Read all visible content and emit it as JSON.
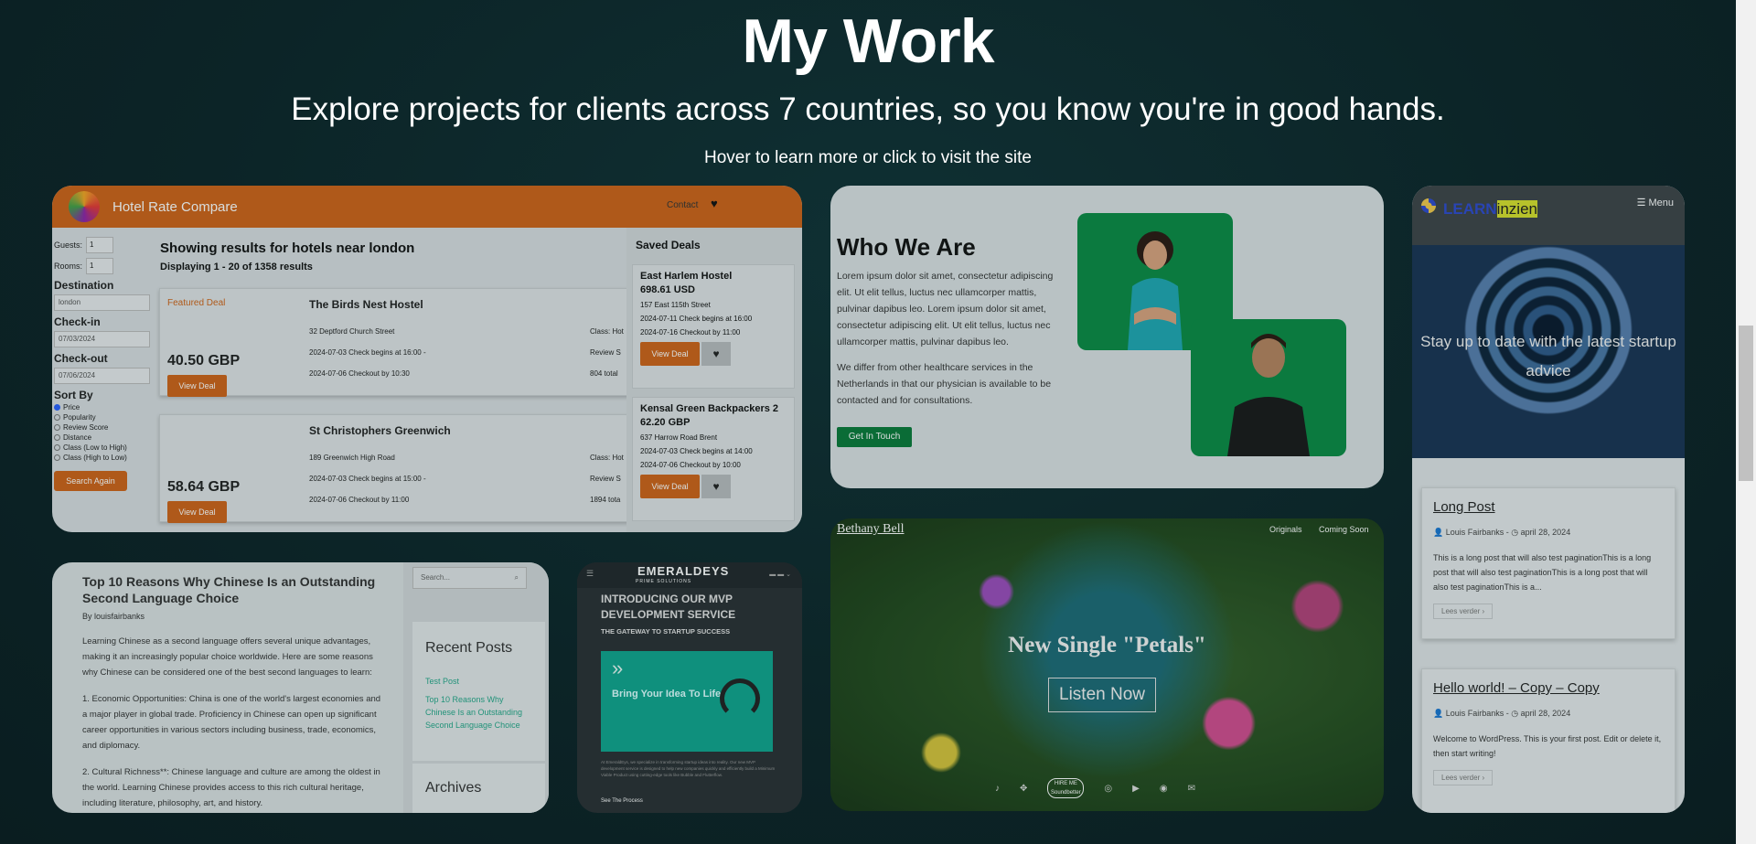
{
  "header": {
    "title": "My Work",
    "subtitle": "Explore projects for clients across 7 countries, so you know you're in good hands.",
    "hint": "Hover to learn more or click to visit the site"
  },
  "hotel": {
    "brand": "Hotel Rate Compare",
    "contact": "Contact",
    "heart_icon": "heart-icon",
    "guests_label": "Guests:",
    "guests_value": "1",
    "rooms_label": "Rooms:",
    "rooms_value": "1",
    "destination_label": "Destination",
    "destination_value": "london",
    "checkin_label": "Check-in",
    "checkin_value": "07/03/2024",
    "checkout_label": "Check-out",
    "checkout_value": "07/06/2024",
    "sortby_label": "Sort By",
    "sort_options": [
      "Price",
      "Popularity",
      "Review Score",
      "Distance",
      "Class (Low to High)",
      "Class (High to Low)"
    ],
    "search_again": "Search Again",
    "results_title": "Showing results for hotels near london",
    "results_sub": "Displaying 1 - 20 of 1358 results",
    "deals": [
      {
        "featured": "Featured Deal",
        "name": "The Birds Nest Hostel",
        "address": "32 Deptford Church Street",
        "checkin": "2024-07-03 Check begins at 16:00 -",
        "checkout": "2024-07-06 Checkout by 10:30",
        "class": "Class: Hot",
        "review": "Review S",
        "reviews": "804 total",
        "price": "40.50 GBP",
        "button": "View Deal"
      },
      {
        "featured": "",
        "name": "St Christophers Greenwich",
        "address": "189 Greenwich High Road",
        "checkin": "2024-07-03 Check begins at 15:00 -",
        "checkout": "2024-07-06 Checkout by 11:00",
        "class": "Class: Hot",
        "review": "Review S",
        "reviews": "1894 tota",
        "price": "58.64 GBP",
        "button": "View Deal"
      }
    ],
    "saved_title": "Saved Deals",
    "saved": [
      {
        "name": "East Harlem Hostel",
        "price": "698.61 USD",
        "address": "157 East 115th Street",
        "checkin": "2024-07-11 Check begins at 16:00",
        "checkout": "2024-07-16 Checkout by 11:00",
        "button": "View Deal"
      },
      {
        "name": "Kensal Green Backpackers 2",
        "price": "62.20 GBP",
        "address": "637 Harrow Road Brent",
        "checkin": "2024-07-03 Check begins at 14:00",
        "checkout": "2024-07-06 Checkout by 10:00",
        "button": "View Deal"
      }
    ]
  },
  "who": {
    "title": "Who We Are",
    "p1": "Lorem ipsum dolor sit amet, consectetur adipiscing elit. Ut elit tellus, luctus nec ullamcorper mattis, pulvinar dapibus leo. Lorem ipsum dolor sit amet, consectetur adipiscing elit. Ut elit tellus, luctus nec ullamcorper mattis, pulvinar dapibus leo.",
    "p2": "We differ from other healthcare services in the Netherlands in that our physician is available to be contacted and for consultations.",
    "button": "Get In Touch"
  },
  "learn": {
    "brand_a": "LEARN",
    "brand_b": "inzien",
    "menu": "☰  Menu",
    "hero": "Stay up to date with the latest startup advice",
    "posts": [
      {
        "title": "Long Post",
        "author": "Louis Fairbanks",
        "date": "april 28, 2024",
        "excerpt": "This is a long post that will also test paginationThis is a long post that will also test paginationThis is a long post that will also test paginationThis is a...",
        "more": "Lees verder ›"
      },
      {
        "title": "Hello world! – Copy – Copy",
        "author": "Louis Fairbanks",
        "date": "april 28, 2024",
        "excerpt": "Welcome to WordPress. This is your first post. Edit or delete it, then start writing!",
        "more": "Lees verder ›"
      }
    ]
  },
  "chinese": {
    "title": "Top 10 Reasons Why Chinese Is an Outstanding Second Language Choice",
    "byline": "By louisfairbanks",
    "p1": "Learning Chinese as a second language offers several unique advantages, making it an increasingly popular choice worldwide. Here are some reasons why Chinese can be considered one of the best second languages to learn:",
    "p2": "1. Economic Opportunities: China is one of the world's largest economies and a major player in global trade. Proficiency in Chinese can open up significant career opportunities in various sectors including business, trade, economics, and diplomacy.",
    "p3": "2. Cultural Richness**: Chinese language and culture are among the oldest in the world. Learning Chinese provides access to this rich cultural heritage, including literature, philosophy, art, and history.",
    "search_placeholder": "Search...",
    "recent_title": "Recent Posts",
    "recent": [
      "Test Post",
      "Top 10 Reasons Why Chinese Is an Outstanding Second Language Choice"
    ],
    "archives_title": "Archives"
  },
  "emerald": {
    "logo": "EMERALDEYS",
    "logo_sub": "PRIME SOLUTIONS",
    "heading": "INTRODUCING OUR MVP DEVELOPMENT SERVICE",
    "tagline": "THE GATEWAY TO STARTUP SUCCESS",
    "box_text": "Bring Your Idea To Life",
    "footer": "At EmeraldEys, we specialize in transforming startup ideas into reality. Our new MVP development service is designed to help new companies quickly and efficiently build a Minimum Viable Product using cutting-edge tools like Bubble and Flutterflow.",
    "see": "See The Process"
  },
  "petals": {
    "artist": "Bethany Bell",
    "nav": [
      "Originals",
      "Coming Soon"
    ],
    "title": "New Single \"Petals\"",
    "button": "Listen Now",
    "badge": "HIRE ME Soundbetter"
  }
}
